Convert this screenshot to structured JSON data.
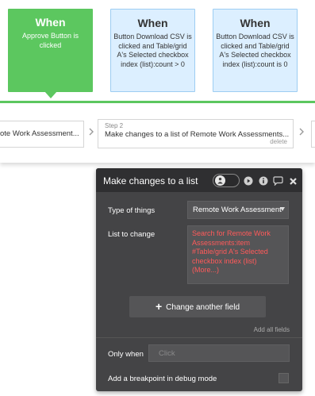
{
  "events": [
    {
      "when": "When",
      "desc": "Approve Button is clicked"
    },
    {
      "when": "When",
      "desc": "Button Download CSV is clicked and Table/grid A's Selected checkbox index (list):count > 0"
    },
    {
      "when": "When",
      "desc": "Button Download CSV is clicked and Table/grid A's Selected checkbox index (list):count is 0"
    }
  ],
  "workflow": {
    "step1_title": "ote Work Assessment...",
    "step2_num": "Step 2",
    "step2_title": "Make changes to a list of Remote Work Assessments...",
    "step2_delete": "delete"
  },
  "panel": {
    "title": "Make changes to a list of",
    "type_label": "Type of things",
    "type_value": "Remote Work Assessment",
    "list_label": "List to change",
    "list_value": [
      "Search for Remote Work",
      "Assessments:item",
      "#Table/grid A's Selected",
      "checkbox index (list)",
      "(More...)"
    ],
    "change_button": "Change another field",
    "add_all": "Add all fields",
    "only_when_label": "Only when",
    "only_when_placeholder": "Click",
    "breakpoint_label": "Add a breakpoint in debug mode"
  },
  "colors": {
    "event_active": "#5cc75f",
    "event_inactive": "#dcefff",
    "panel_bg": "#444446",
    "expression_red": "#ff5a5a"
  },
  "icons": [
    "arrow-right-icon",
    "person-icon",
    "play-icon",
    "info-icon",
    "comment-icon",
    "close-icon",
    "plus-icon"
  ]
}
